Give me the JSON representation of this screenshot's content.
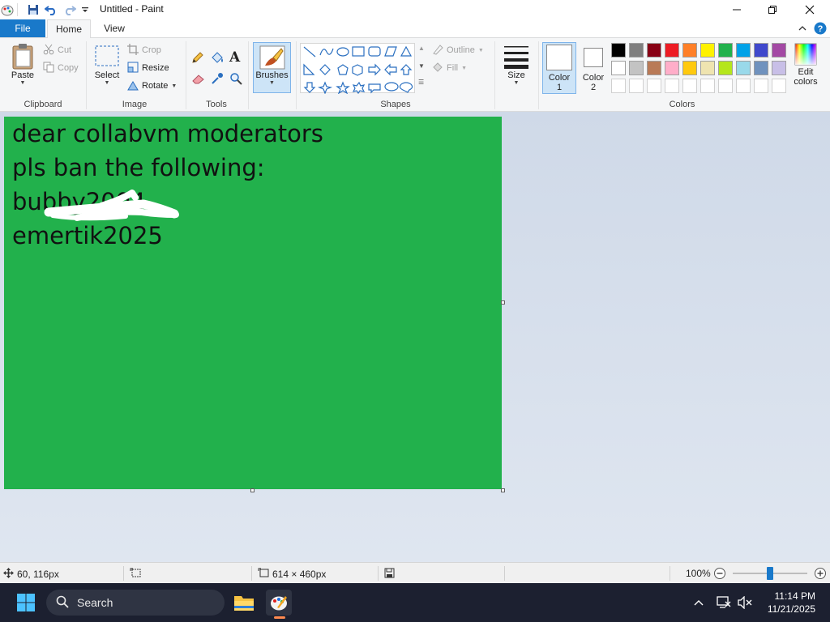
{
  "window": {
    "title": "Untitled - Paint"
  },
  "tabs": {
    "file": "File",
    "home": "Home",
    "view": "View"
  },
  "clipboard": {
    "paste": "Paste",
    "cut": "Cut",
    "copy": "Copy",
    "group": "Clipboard"
  },
  "image": {
    "select": "Select",
    "crop": "Crop",
    "resize": "Resize",
    "rotate": "Rotate",
    "group": "Image"
  },
  "tools": {
    "group": "Tools"
  },
  "brushes": {
    "label": "Brushes"
  },
  "shapes": {
    "outline": "Outline",
    "fill": "Fill",
    "group": "Shapes"
  },
  "size": {
    "label": "Size"
  },
  "colors": {
    "color1": "Color 1",
    "color2": "Color 2",
    "edit": "Edit colors",
    "group": "Colors",
    "palette_row1": [
      "#000000",
      "#7f7f7f",
      "#880015",
      "#ed1c24",
      "#ff7f27",
      "#fff200",
      "#22b14c",
      "#00a2e8",
      "#3f48cc",
      "#a349a4"
    ],
    "palette_row2": [
      "#ffffff",
      "#c3c3c3",
      "#b97a57",
      "#ffaec9",
      "#ffc90e",
      "#efe4b0",
      "#b5e61d",
      "#99d9ea",
      "#7092be",
      "#c8bfe7"
    ]
  },
  "canvas": {
    "background": "#22b14c",
    "lines": [
      "dear collabvm moderators",
      "pls ban the following:",
      "bubby2004",
      "emertik2025"
    ]
  },
  "status": {
    "cursor": "60, 116px",
    "dimensions": "614 × 460px",
    "zoom": "100%",
    "zoom_level": 0.5
  },
  "taskbar": {
    "search": "Search",
    "time": "11:14 PM",
    "date": "11/21/2025"
  }
}
